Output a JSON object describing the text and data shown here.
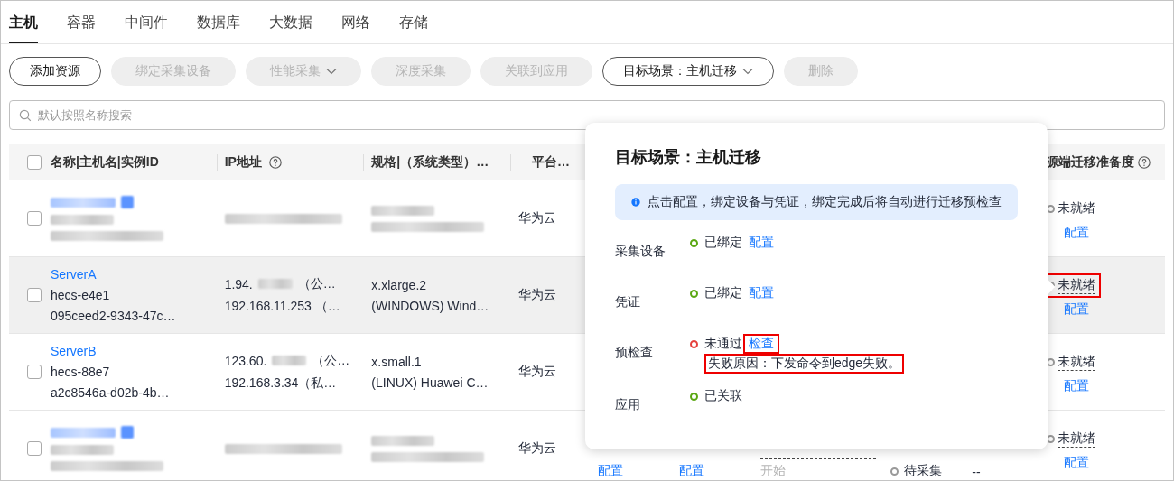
{
  "tabs": [
    {
      "label": "主机",
      "selected": true
    },
    {
      "label": "容器",
      "selected": false
    },
    {
      "label": "中间件",
      "selected": false
    },
    {
      "label": "数据库",
      "selected": false
    },
    {
      "label": "大数据",
      "selected": false
    },
    {
      "label": "网络",
      "selected": false
    },
    {
      "label": "存储",
      "selected": false
    }
  ],
  "toolbar": [
    {
      "label": "添加资源",
      "disabled": false,
      "dropdown": false
    },
    {
      "label": "绑定采集设备",
      "disabled": true,
      "dropdown": false
    },
    {
      "label": "性能采集",
      "disabled": true,
      "dropdown": true
    },
    {
      "label": "深度采集",
      "disabled": true,
      "dropdown": false
    },
    {
      "label": "关联到应用",
      "disabled": true,
      "dropdown": false
    },
    {
      "label": "目标场景：主机迁移",
      "disabled": false,
      "dropdown": true
    },
    {
      "label": "删除",
      "disabled": true,
      "dropdown": false
    }
  ],
  "search": {
    "placeholder": "默认按照名称搜索"
  },
  "table": {
    "select_all": false,
    "columns": [
      {
        "label": "名称|主机名|实例ID",
        "help": false
      },
      {
        "label": "IP地址",
        "help": true
      },
      {
        "label": "规格|（系统类型）…",
        "help": false
      },
      {
        "label": "平台…",
        "help": false
      },
      {
        "label": "源端迁移准备度",
        "help": true
      }
    ],
    "rows": [
      {
        "kind": "masked",
        "checked": false,
        "selected": false,
        "platform": "华为云",
        "readiness": {
          "status": "未就绪",
          "action": "配置",
          "highlighted": false
        }
      },
      {
        "kind": "plain",
        "checked": false,
        "selected": true,
        "name": "ServerA",
        "hostname": "hecs-e4e1",
        "instance_id": "095ceed2-9343-47c…",
        "ip": [
          {
            "text": "1.94.",
            "masked": true,
            "suffix": "（公…"
          },
          {
            "text": "192.168.11.253 （…",
            "masked": false
          }
        ],
        "spec": [
          "x.xlarge.2",
          "(WINDOWS) Wind…"
        ],
        "platform": "华为云",
        "readiness": {
          "status": "未就绪",
          "action": "配置",
          "highlighted": true
        }
      },
      {
        "kind": "plain",
        "checked": false,
        "selected": false,
        "name": "ServerB",
        "hostname": "hecs-88e7",
        "instance_id": "a2c8546a-d02b-4b…",
        "ip": [
          {
            "text": "123.60.",
            "masked": true,
            "suffix": "（公…"
          },
          {
            "text": "192.168.3.34（私…",
            "masked": false
          }
        ],
        "spec": [
          "x.small.1",
          "(LINUX) Huawei C…"
        ],
        "platform": "华为云",
        "readiness": {
          "status": "未就绪",
          "action": "配置",
          "highlighted": false
        }
      },
      {
        "kind": "masked",
        "checked": false,
        "selected": false,
        "platform": "华为云",
        "extra_cells": [
          {
            "kind": "link",
            "text": "配置"
          },
          {
            "kind": "link",
            "text": "配置"
          },
          {
            "kind": "muted",
            "text": "开始"
          },
          {
            "kind": "status",
            "text": "待采集"
          },
          {
            "kind": "plain",
            "text": "--"
          }
        ],
        "readiness": {
          "status": "未就绪",
          "action": "配置",
          "highlighted": false
        }
      }
    ]
  },
  "popover": {
    "title": "目标场景：主机迁移",
    "notice": "点击配置，绑定设备与凭证，绑定完成后将自动进行迁移预检查",
    "items": [
      {
        "label": "采集设备",
        "status": "已绑定",
        "passed": true,
        "action": "配置",
        "action_highlighted": false
      },
      {
        "label": "凭证",
        "status": "已绑定",
        "passed": true,
        "action": "配置",
        "action_highlighted": false
      },
      {
        "label": "预检查",
        "status": "未通过",
        "passed": false,
        "action": "检查",
        "action_highlighted": true,
        "reason": "失败原因：下发命令到edge失败。",
        "reason_highlighted": true
      },
      {
        "label": "应用",
        "status": "已关联",
        "passed": true
      }
    ]
  }
}
